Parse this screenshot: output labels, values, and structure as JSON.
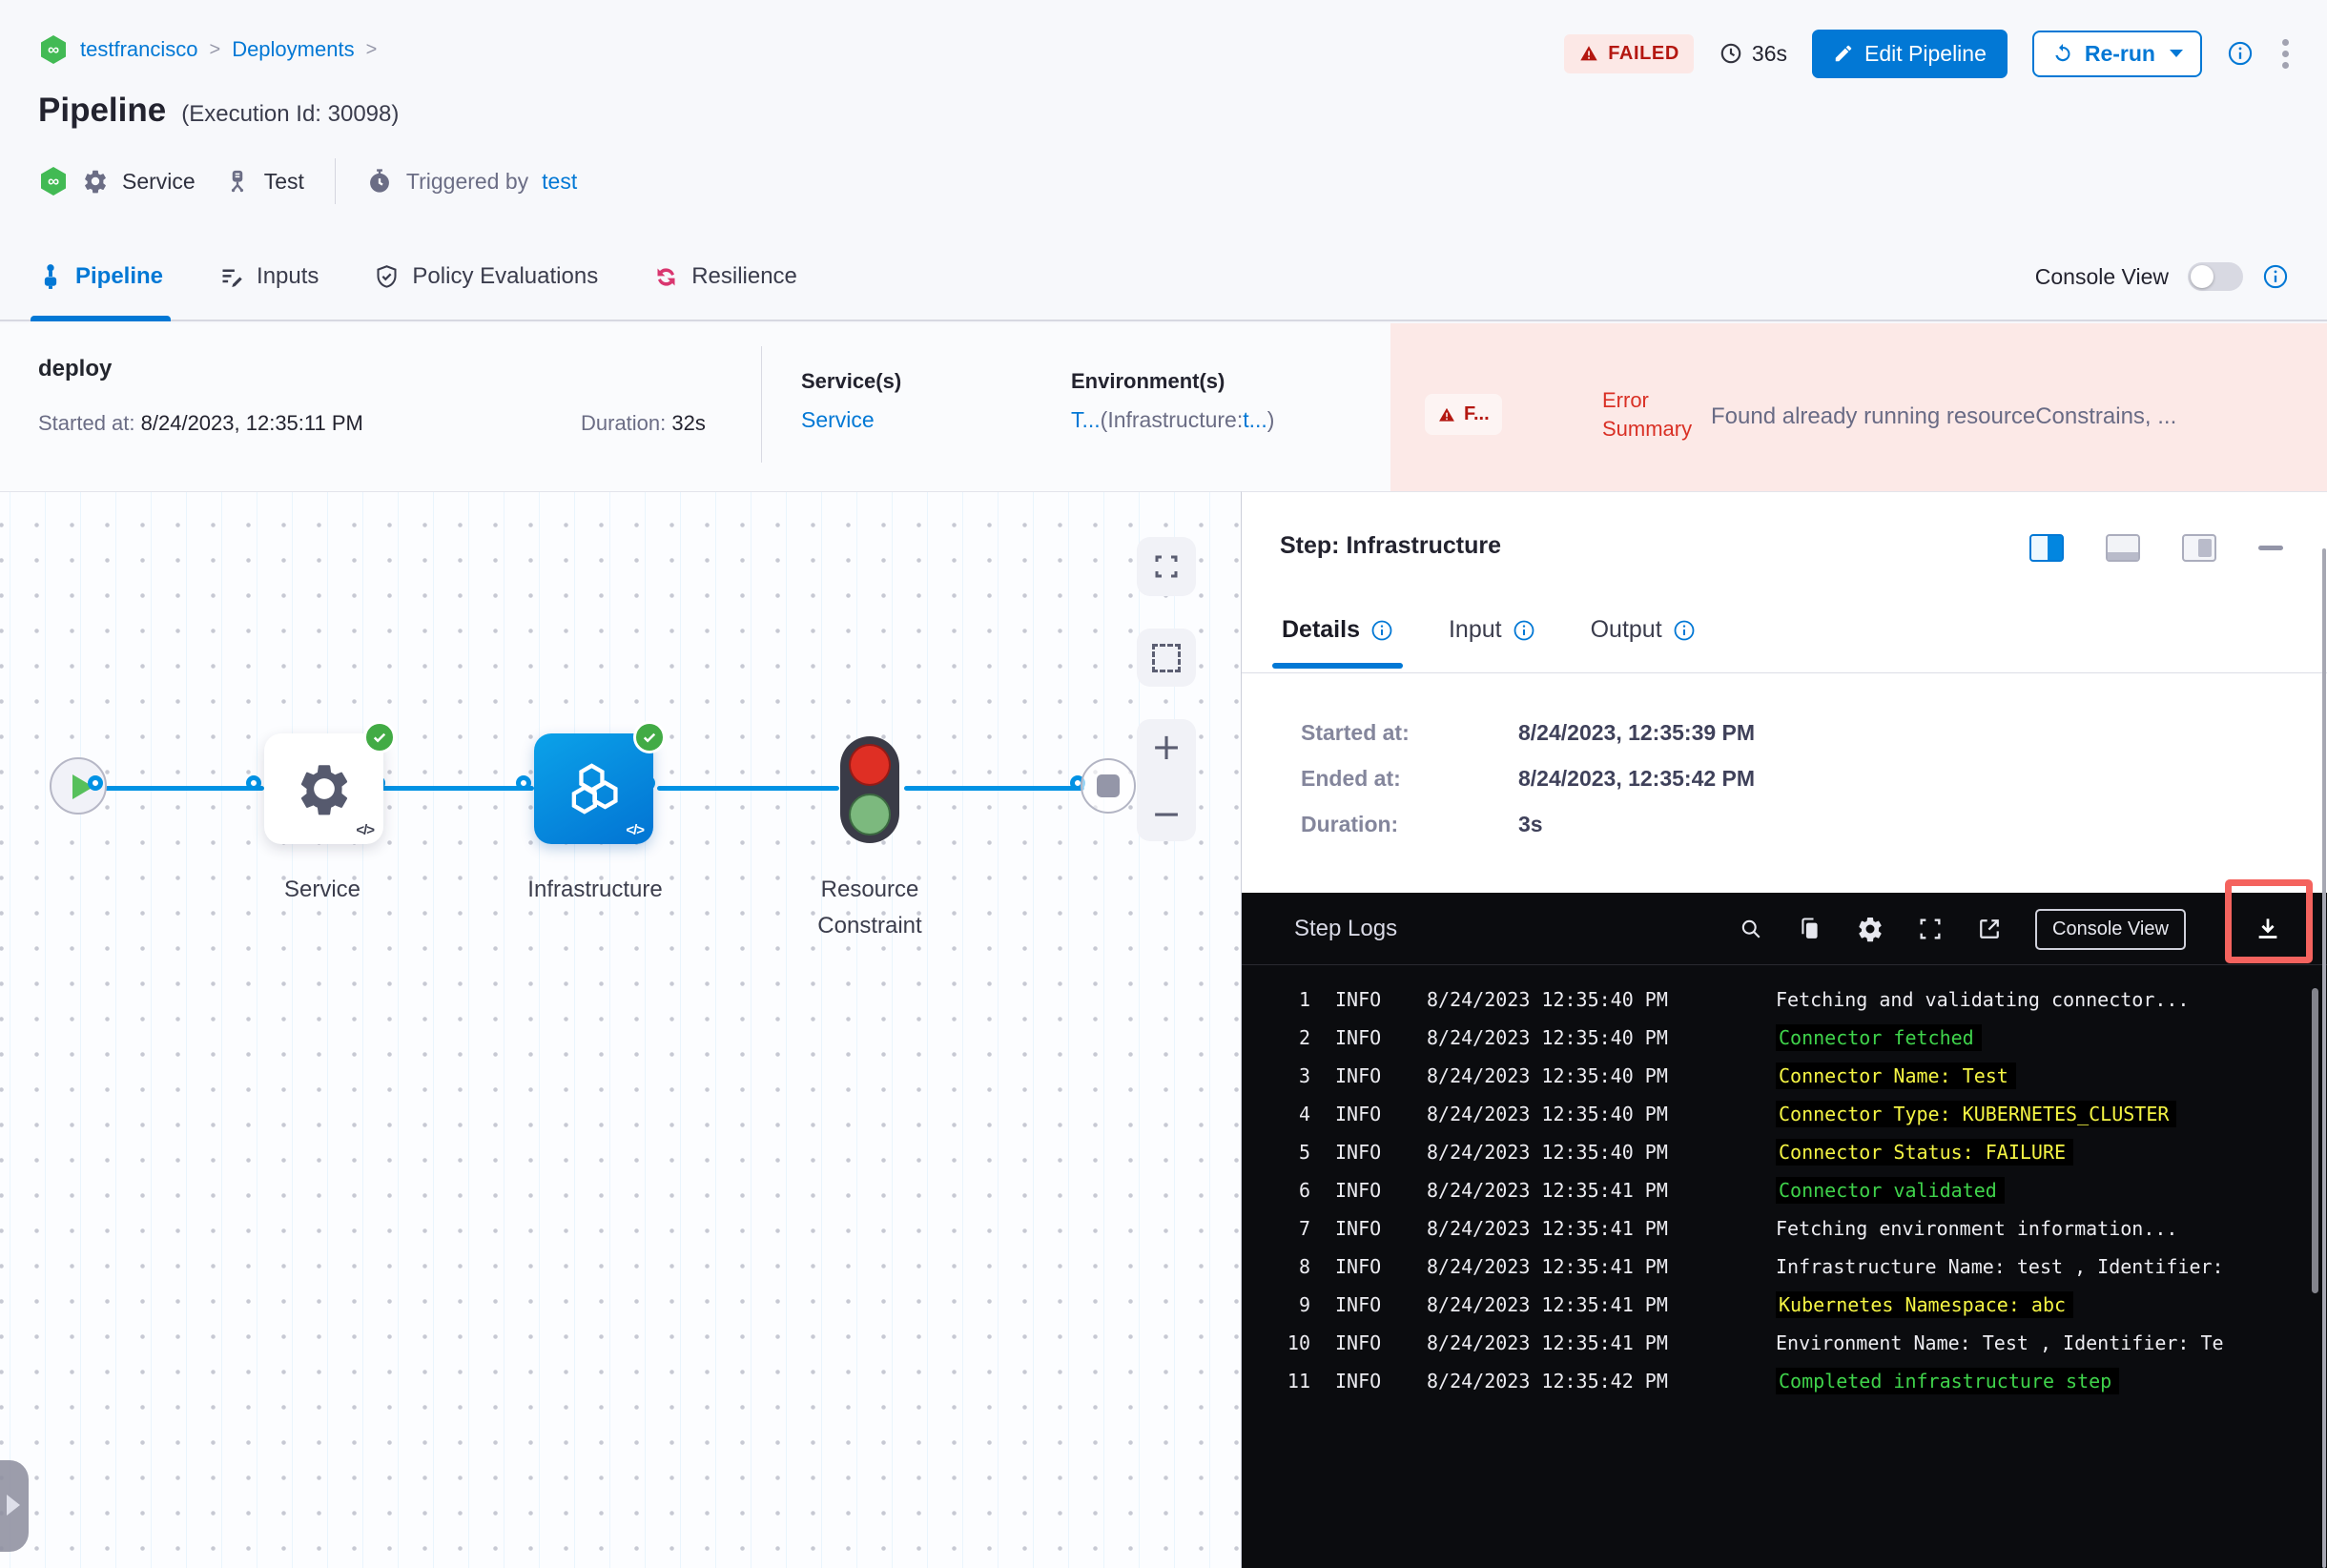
{
  "colors": {
    "primary": "#0278d5",
    "failed_text": "#b41710",
    "failed_bg": "#fce8e6",
    "success_green": "#42ab45",
    "log_green": "#3fd34b",
    "log_yellow": "#f5f544",
    "resilience_pink": "#d9366f",
    "console_bg": "#0b0c0f",
    "highlight_red": "#f4635e"
  },
  "breadcrumb": {
    "items": [
      {
        "label": "testfrancisco"
      },
      {
        "label": "Deployments"
      }
    ],
    "separator": ">"
  },
  "header": {
    "title": "Pipeline",
    "execution_id": "(Execution Id: 30098)",
    "status_badge": "FAILED",
    "elapsed": "36s",
    "edit_pipeline_label": "Edit Pipeline",
    "rerun_label": "Re-run"
  },
  "meta": {
    "service_label": "Service",
    "environment_label": "Test",
    "triggered_by_label": "Triggered by",
    "triggered_by_user": "test"
  },
  "tabs": {
    "items": [
      {
        "label": "Pipeline"
      },
      {
        "label": "Inputs"
      },
      {
        "label": "Policy Evaluations"
      },
      {
        "label": "Resilience"
      }
    ],
    "console_view_label": "Console View"
  },
  "stage": {
    "name": "deploy",
    "started_label": "Started at:",
    "started_value": "8/24/2023, 12:35:11 PM",
    "duration_label": "Duration:",
    "duration_value": "32s",
    "services_label": "Service(s)",
    "service_link": "Service",
    "environments_label": "Environment(s)",
    "environment_link": "T...",
    "environment_detail_prefix": "(Infrastructure:",
    "environment_detail_link": "t...",
    "environment_detail_suffix": ")",
    "error_badge": "F...",
    "error_summary_label": "Error Summary",
    "error_message": "Found already running resourceConstrains, ..."
  },
  "graph": {
    "node_labels": [
      "Service",
      "Infrastructure",
      "Resource Constraint"
    ]
  },
  "panel": {
    "title": "Step: Infrastructure",
    "tabs": [
      {
        "label": "Details"
      },
      {
        "label": "Input"
      },
      {
        "label": "Output"
      }
    ],
    "details": [
      {
        "label": "Started at:",
        "value": "8/24/2023, 12:35:39 PM"
      },
      {
        "label": "Ended at:",
        "value": "8/24/2023, 12:35:42 PM"
      },
      {
        "label": "Duration:",
        "value": "3s"
      }
    ]
  },
  "logs": {
    "title": "Step Logs",
    "console_view_button": "Console View",
    "lines": [
      {
        "num": "1",
        "level": "INFO",
        "time": "8/24/2023 12:35:40 PM",
        "msg": "Fetching and validating connector...",
        "color": "white"
      },
      {
        "num": "2",
        "level": "INFO",
        "time": "8/24/2023 12:35:40 PM",
        "msg": "Connector fetched",
        "color": "green"
      },
      {
        "num": "3",
        "level": "INFO",
        "time": "8/24/2023 12:35:40 PM",
        "msg": "Connector Name: Test",
        "color": "yellow"
      },
      {
        "num": "4",
        "level": "INFO",
        "time": "8/24/2023 12:35:40 PM",
        "msg": "Connector Type: KUBERNETES_CLUSTER",
        "color": "yellow"
      },
      {
        "num": "5",
        "level": "INFO",
        "time": "8/24/2023 12:35:40 PM",
        "msg": "Connector Status: FAILURE",
        "color": "yellow"
      },
      {
        "num": "6",
        "level": "INFO",
        "time": "8/24/2023 12:35:41 PM",
        "msg": "Connector validated",
        "color": "green"
      },
      {
        "num": "7",
        "level": "INFO",
        "time": "8/24/2023 12:35:41 PM",
        "msg": "Fetching environment information...",
        "color": "white"
      },
      {
        "num": "8",
        "level": "INFO",
        "time": "8/24/2023 12:35:41 PM",
        "msg": "Infrastructure Name: test , Identifier:",
        "color": "white"
      },
      {
        "num": "9",
        "level": "INFO",
        "time": "8/24/2023 12:35:41 PM",
        "msg": "Kubernetes Namespace: abc",
        "color": "yellow"
      },
      {
        "num": "10",
        "level": "INFO",
        "time": "8/24/2023 12:35:41 PM",
        "msg": "Environment Name: Test , Identifier: Te",
        "color": "white"
      },
      {
        "num": "11",
        "level": "INFO",
        "time": "8/24/2023 12:35:42 PM",
        "msg": "Completed infrastructure step",
        "color": "green"
      }
    ]
  }
}
